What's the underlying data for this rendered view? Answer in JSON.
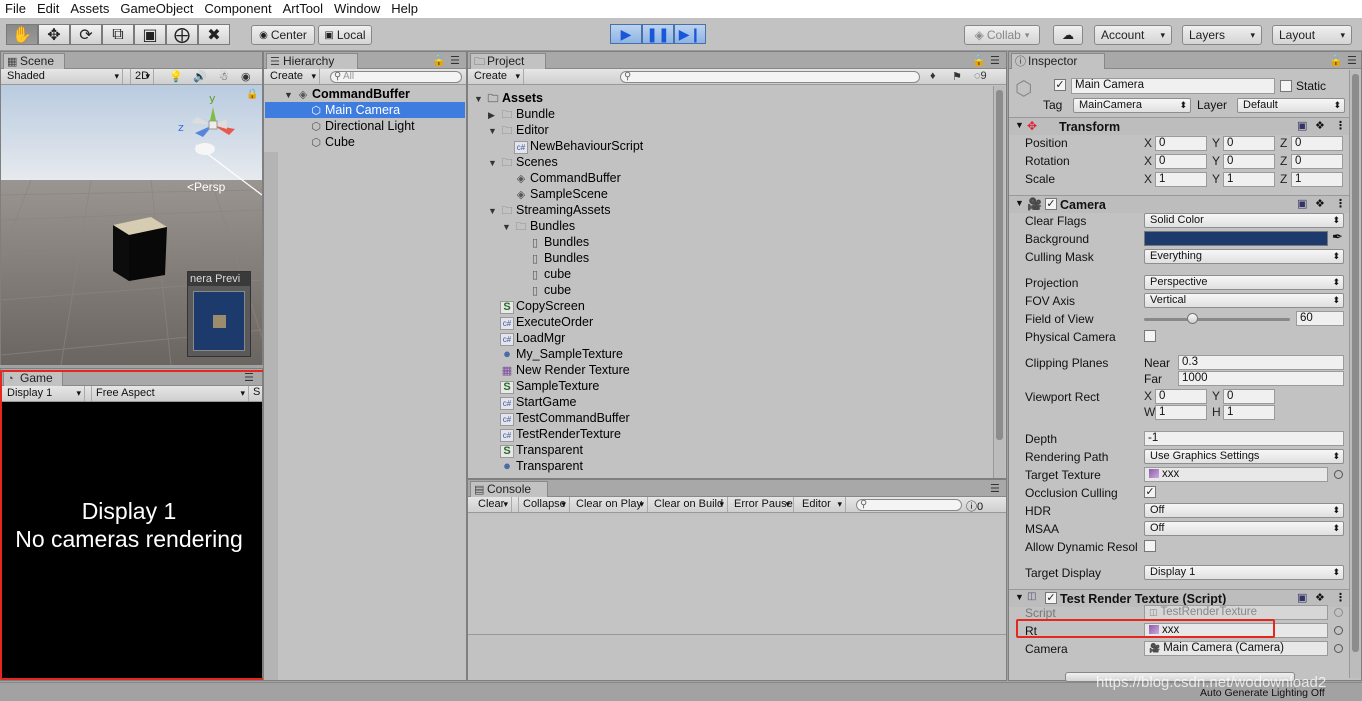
{
  "menu": [
    "File",
    "Edit",
    "Assets",
    "GameObject",
    "Component",
    "ArtTool",
    "Window",
    "Help"
  ],
  "toolbar": {
    "pivot": "Center",
    "space": "Local",
    "collab": "Collab",
    "account": "Account",
    "layers": "Layers",
    "layout": "Layout"
  },
  "scene": {
    "tab": "Scene",
    "shading": "Shaded",
    "mode2d": "2D",
    "persp": "<Persp",
    "camera_preview": "nera Previ",
    "axis_y": "y",
    "axis_z": "z"
  },
  "game": {
    "tab": "Game",
    "display": "Display 1",
    "aspect": "Free Aspect",
    "scale": "S",
    "message_line1": "Display 1",
    "message_line2": "No cameras rendering"
  },
  "hierarchy": {
    "tab": "Hierarchy",
    "create": "Create",
    "search_placeholder": "All",
    "scene": "CommandBuffer",
    "items": [
      "Main Camera",
      "Directional Light",
      "Cube"
    ]
  },
  "project": {
    "tab": "Project",
    "create": "Create",
    "hidden_count": "9",
    "items": [
      {
        "label": "Assets",
        "depth": 0,
        "icon": "folder",
        "fold": "open"
      },
      {
        "label": "Bundle",
        "depth": 1,
        "icon": "folder",
        "fold": "closed"
      },
      {
        "label": "Editor",
        "depth": 1,
        "icon": "folder",
        "fold": "open"
      },
      {
        "label": "NewBehaviourScript",
        "depth": 2,
        "icon": "cs"
      },
      {
        "label": "Scenes",
        "depth": 1,
        "icon": "folder",
        "fold": "open"
      },
      {
        "label": "CommandBuffer",
        "depth": 2,
        "icon": "unity"
      },
      {
        "label": "SampleScene",
        "depth": 2,
        "icon": "unity"
      },
      {
        "label": "StreamingAssets",
        "depth": 1,
        "icon": "folder",
        "fold": "open"
      },
      {
        "label": "Bundles",
        "depth": 2,
        "icon": "folder",
        "fold": "open"
      },
      {
        "label": "Bundles",
        "depth": 3,
        "icon": "file"
      },
      {
        "label": "Bundles",
        "depth": 3,
        "icon": "file"
      },
      {
        "label": "cube",
        "depth": 3,
        "icon": "file"
      },
      {
        "label": "cube",
        "depth": 3,
        "icon": "file"
      },
      {
        "label": "CopyScreen",
        "depth": 1,
        "icon": "shader"
      },
      {
        "label": "ExecuteOrder",
        "depth": 1,
        "icon": "cs"
      },
      {
        "label": "LoadMgr",
        "depth": 1,
        "icon": "cs"
      },
      {
        "label": "My_SampleTexture",
        "depth": 1,
        "icon": "material"
      },
      {
        "label": "New Render Texture",
        "depth": 1,
        "icon": "rendertex"
      },
      {
        "label": "SampleTexture",
        "depth": 1,
        "icon": "shader"
      },
      {
        "label": "StartGame",
        "depth": 1,
        "icon": "cs"
      },
      {
        "label": "TestCommandBuffer",
        "depth": 1,
        "icon": "cs"
      },
      {
        "label": "TestRenderTexture",
        "depth": 1,
        "icon": "cs"
      },
      {
        "label": "Transparent",
        "depth": 1,
        "icon": "shader"
      },
      {
        "label": "Transparent",
        "depth": 1,
        "icon": "material"
      }
    ]
  },
  "console": {
    "tab": "Console",
    "buttons": [
      "Clear",
      "Collapse",
      "Clear on Play",
      "Clear on Build",
      "Error Pause",
      "Editor"
    ],
    "error_count": "0"
  },
  "inspector": {
    "tab": "Inspector",
    "name": "Main Camera",
    "static": "Static",
    "tag_label": "Tag",
    "tag": "MainCamera",
    "layer_label": "Layer",
    "layer": "Default",
    "transform": {
      "title": "Transform",
      "position_label": "Position",
      "rotation_label": "Rotation",
      "scale_label": "Scale",
      "position": [
        "0",
        "0",
        "0"
      ],
      "rotation": [
        "0",
        "0",
        "0"
      ],
      "scale": [
        "1",
        "1",
        "1"
      ]
    },
    "camera": {
      "title": "Camera",
      "clear_flags_label": "Clear Flags",
      "clear_flags": "Solid Color",
      "background_label": "Background",
      "background_color": "#1c3a6b",
      "culling_mask_label": "Culling Mask",
      "culling_mask": "Everything",
      "projection_label": "Projection",
      "projection": "Perspective",
      "fov_axis_label": "FOV Axis",
      "fov_axis": "Vertical",
      "fov_label": "Field of View",
      "fov": "60",
      "physical_label": "Physical Camera",
      "clipping_label": "Clipping Planes",
      "near_label": "Near",
      "near": "0.3",
      "far_label": "Far",
      "far": "1000",
      "viewport_label": "Viewport Rect",
      "vx": "0",
      "vy": "0",
      "vw": "1",
      "vh": "1",
      "depth_label": "Depth",
      "depth": "-1",
      "rendering_path_label": "Rendering Path",
      "rendering_path": "Use Graphics Settings",
      "target_texture_label": "Target Texture",
      "target_texture": "xxx",
      "occlusion_label": "Occlusion Culling",
      "hdr_label": "HDR",
      "hdr": "Off",
      "msaa_label": "MSAA",
      "msaa": "Off",
      "dynamic_res_label": "Allow Dynamic Resol",
      "target_display_label": "Target Display",
      "target_display": "Display 1"
    },
    "script_comp": {
      "title": "Test Render Texture (Script)",
      "script_label": "Script",
      "script": "TestRenderTexture",
      "rt_label": "Rt",
      "rt": "xxx",
      "camera_label": "Camera",
      "camera": "Main Camera (Camera)"
    }
  },
  "status": {
    "right": "Auto Generate Lighting Off",
    "watermark": "https://blog.csdn.net/wodownload2"
  },
  "colors": {
    "selection": "#3e7ce0",
    "highlight_box": "#e5281f",
    "play_blue": "#1a56d8"
  }
}
